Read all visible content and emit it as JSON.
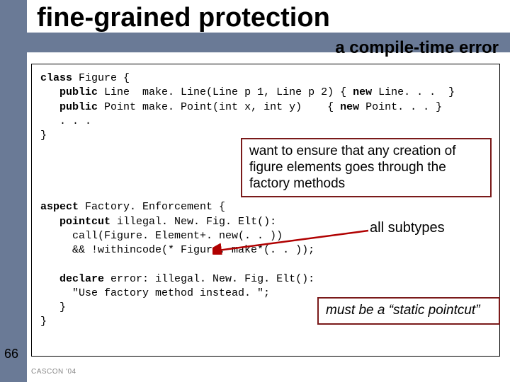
{
  "title": "fine-grained protection",
  "subtitle": "a compile-time error",
  "code": {
    "l1a": "class",
    "l1b": " Figure {",
    "l2a": "   public",
    "l2b": " Line  make. Line(Line p 1, Line p 2) { ",
    "l2c": "new",
    "l2d": " Line. . .  }",
    "l3a": "   public",
    "l3b": " Point make. Point(int x, int y)    { ",
    "l3c": "new",
    "l3d": " Point. . . }",
    "l4": "   . . .",
    "l5": "}",
    "blank1": "",
    "blank2": "",
    "blank3": "",
    "blank4": "",
    "l6a": "aspect",
    "l6b": " Factory. Enforcement {",
    "l7a": "   pointcut",
    "l7b": " illegal. New. Fig. Elt():",
    "l8": "     call(Figure. Element+. new(. . ))",
    "l9": "     && !withincode(* Figure. make*(. . ));",
    "blank5": "",
    "l10a": "   declare",
    "l10b": " error: illegal. New. Fig. Elt():",
    "l11": "     \"Use factory method instead. \";",
    "l12": "   }",
    "l13": "}"
  },
  "callout1": "want to ensure that any creation of figure elements goes through the factory methods",
  "callout2": "must be a “static pointcut”",
  "label_all_subtypes": "all subtypes",
  "slide_number": "66",
  "footer": "CASCON '04"
}
